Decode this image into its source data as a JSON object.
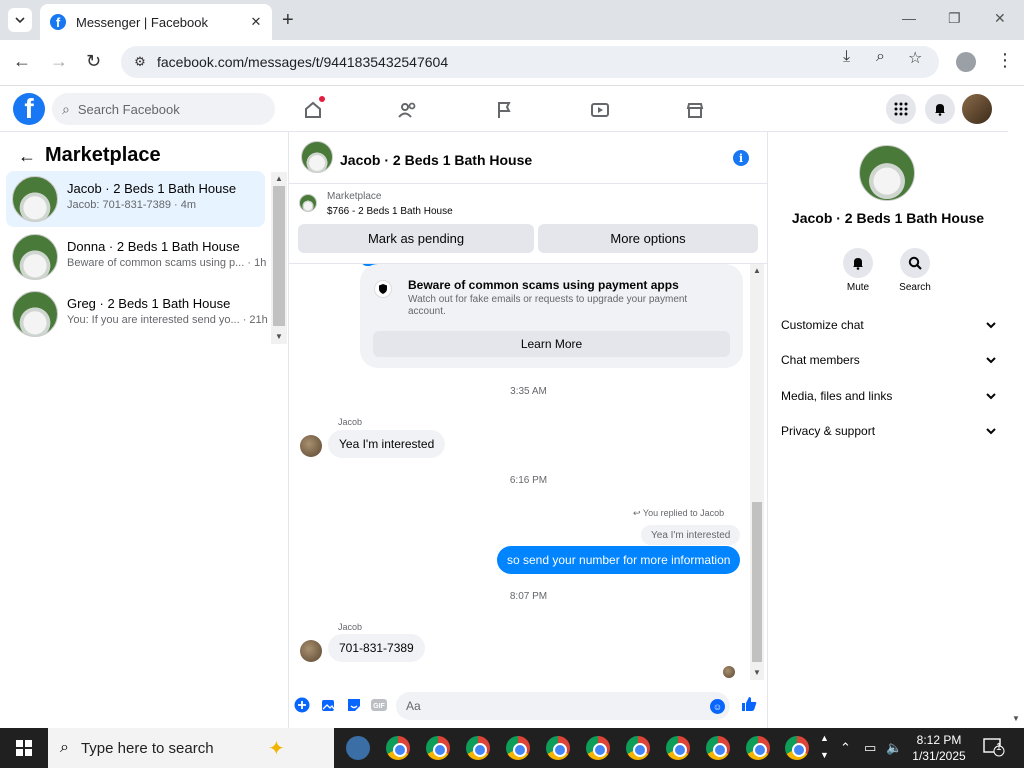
{
  "browser": {
    "tab_title": "Messenger | Facebook",
    "url": "facebook.com/messages/t/9441835432547604"
  },
  "fb": {
    "search_placeholder": "Search Facebook"
  },
  "left": {
    "title": "Marketplace",
    "threads": [
      {
        "name": "Jacob · 2 Beds 1 Bath House",
        "preview": "Jacob: 701-831-7389 · 4m"
      },
      {
        "name": "Donna · 2 Beds 1 Bath House",
        "preview": "Beware of common scams using p... · 1h"
      },
      {
        "name": "Greg · 2 Beds 1 Bath House",
        "preview": "You: If you are interested send yo... · 21h"
      }
    ]
  },
  "conversation": {
    "title": "Jacob · 2 Beds 1 Bath House",
    "marketplace_label": "Marketplace",
    "listing": "$766 - 2 Beds 1 Bath House",
    "mark_pending": "Mark as pending",
    "more_options": "More options",
    "scam_title": "Beware of common scams using payment apps",
    "scam_body": "Watch out for fake emails or requests to upgrade your payment account.",
    "learn_more": "Learn More",
    "time1": "3:35 AM",
    "sender1": "Jacob",
    "msg1": "Yea I'm interested",
    "time2": "6:16 PM",
    "reply_note": "You replied to Jacob",
    "quoted": "Yea I'm interested",
    "msg_out": "so send your number for more information",
    "time3": "8:07 PM",
    "sender2": "Jacob",
    "msg2": "701-831-7389",
    "input_placeholder": "Aa"
  },
  "right": {
    "name": "Jacob · 2 Beds 1 Bath House",
    "mute": "Mute",
    "search": "Search",
    "rows": [
      "Customize chat",
      "Chat members",
      "Media, files and links",
      "Privacy & support"
    ]
  },
  "taskbar": {
    "search_placeholder": "Type here to search",
    "time": "8:12 PM",
    "date": "1/31/2025",
    "notifications": "1"
  },
  "colors": {
    "fb_blue": "#1877f2",
    "messenger_blue": "#0084ff",
    "active_thread": "#e7f3ff"
  }
}
